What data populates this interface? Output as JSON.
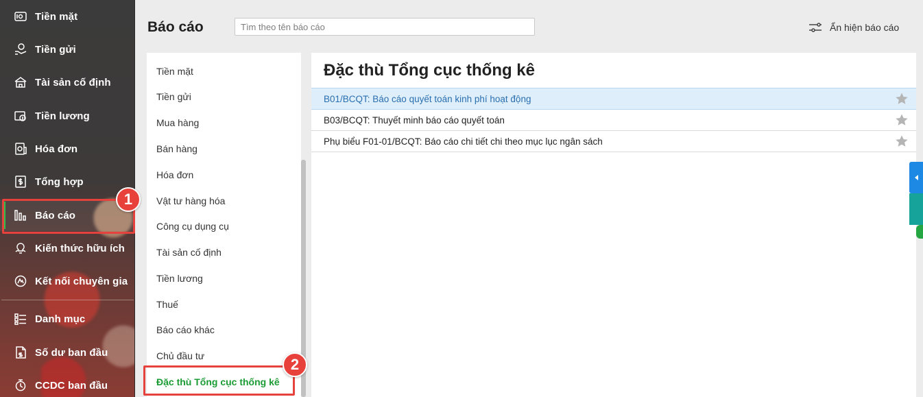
{
  "sidebar": {
    "items": [
      {
        "label": "Tiền mặt",
        "icon": "cash-icon"
      },
      {
        "label": "Tiền gửi",
        "icon": "deposit-icon"
      },
      {
        "label": "Tài sản cố định",
        "icon": "fixed-asset-icon"
      },
      {
        "label": "Tiền lương",
        "icon": "salary-icon"
      },
      {
        "label": "Hóa đơn",
        "icon": "invoice-icon"
      },
      {
        "label": "Tổng hợp",
        "icon": "summary-icon"
      },
      {
        "label": "Báo cáo",
        "icon": "report-chart-icon"
      },
      {
        "label": "Kiến thức hữu ích",
        "icon": "lightbulb-icon"
      },
      {
        "label": "Kết nối chuyên gia",
        "icon": "expert-connect-icon"
      },
      {
        "label": "Danh mục",
        "icon": "catalog-icon"
      },
      {
        "label": "Số dư ban đầu",
        "icon": "opening-balance-icon"
      },
      {
        "label": "CCDC ban đầu",
        "icon": "tools-icon"
      }
    ],
    "active_index": 6
  },
  "header": {
    "title": "Báo cáo",
    "search_placeholder": "Tìm theo tên báo cáo",
    "toggle_label": "Ẩn hiện báo cáo"
  },
  "categories": {
    "items": [
      "Tiền mặt",
      "Tiền gửi",
      "Mua hàng",
      "Bán hàng",
      "Hóa đơn",
      "Vật tư hàng hóa",
      "Công cụ dụng cụ",
      "Tài sản cố định",
      "Tiền lương",
      "Thuế",
      "Báo cáo khác",
      "Chủ đầu tư",
      "Đặc thù Tổng cục thống kê"
    ],
    "active_index": 12
  },
  "reports": {
    "title": "Đặc thù Tổng cục thống kê",
    "rows": [
      {
        "label": "B01/BCQT: Báo cáo quyết toán kinh phí hoạt động"
      },
      {
        "label": "B03/BCQT: Thuyết minh báo cáo quyết toán"
      },
      {
        "label": "Phụ biểu F01-01/BCQT: Báo cáo chi tiết chi theo mục lục ngân sách"
      }
    ],
    "selected_index": 0
  },
  "annotations": {
    "badge_1": "1",
    "badge_2": "2"
  },
  "colors": {
    "active_green": "#1a9b33",
    "highlight_red": "#e5413d",
    "selected_row_bg": "#deeefb",
    "link_blue": "#2a6fb0"
  }
}
